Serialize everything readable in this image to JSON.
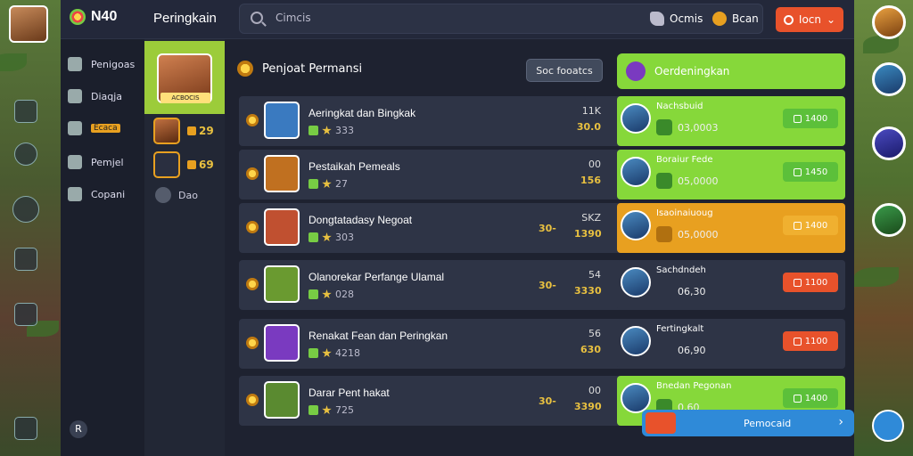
{
  "topbar": {
    "logo_text": "N40",
    "title": "Peringkain",
    "search_placeholder": "Cimcis",
    "shop_label": "Ocmis",
    "gold_label": "Bcan",
    "login_label": "Iocn"
  },
  "sidenav": {
    "items": [
      {
        "label": "Penigoas",
        "icon": "home-icon"
      },
      {
        "label": "Diaqja",
        "icon": "grid-icon"
      },
      {
        "label": "Ecaca",
        "icon": "star-icon"
      },
      {
        "label": "Pemjel",
        "icon": "chat-icon"
      },
      {
        "label": "Copani",
        "icon": "shield-icon"
      }
    ],
    "bottom_label": "R"
  },
  "col2": {
    "hero_tag": "ACBOCIS",
    "stat1": "29",
    "stat2": "69",
    "setting_label": "Dao"
  },
  "main": {
    "heading": "Penjoat Permansi",
    "sort_label": "Soc fooatcs",
    "promo_label": "Oerdeningkan",
    "rows": [
      {
        "name": "Aeringkat dan Bingkak",
        "rating": "333",
        "stat_a": "11K",
        "stat_pre": "",
        "stat_b": "30.0",
        "r_name": "Nachsbuid",
        "r_value": "03,0003",
        "btn": "1400",
        "theme": "green"
      },
      {
        "name": "Pestaikah Pemeals",
        "rating": "27",
        "stat_a": "00",
        "stat_pre": "",
        "stat_b": "156",
        "r_name": "Boraiur Fede",
        "r_value": "05,0000",
        "btn": "1450",
        "theme": "green"
      },
      {
        "name": "Dongtatadasy Negoat",
        "rating": "303",
        "stat_a": "SKZ",
        "stat_pre": "30-",
        "stat_b": "1390",
        "r_name": "Isaoinaiuoug",
        "r_value": "05,0000",
        "btn": "1400",
        "theme": "orange"
      },
      {
        "name": "Olanorekar Perfange Ulamal",
        "rating": "028",
        "stat_a": "54",
        "stat_pre": "30-",
        "stat_b": "3330",
        "r_name": "Sachdndeh",
        "r_value": "06,30",
        "btn": "1100",
        "theme": "dark"
      },
      {
        "name": "Renakat Fean dan Peringkan",
        "rating": "4218",
        "stat_a": "56",
        "stat_pre": "",
        "stat_b": "630",
        "r_name": "Fertingkalt",
        "r_value": "06,90",
        "btn": "1100",
        "theme": "dark"
      },
      {
        "name": "Darar Pent hakat",
        "rating": "725",
        "stat_a": "00",
        "stat_pre": "30-",
        "stat_b": "3390",
        "r_name": "Bnedan Pegonan",
        "r_value": "0,60",
        "btn": "1400",
        "theme": "green"
      }
    ]
  },
  "bottom_bar": {
    "label": "Pemocaid"
  },
  "colors": {
    "accent_green": "#86d83a",
    "accent_orange": "#e8522b",
    "gold": "#e8c040",
    "blue": "#2f8ad8",
    "panel": "#2e3446"
  }
}
